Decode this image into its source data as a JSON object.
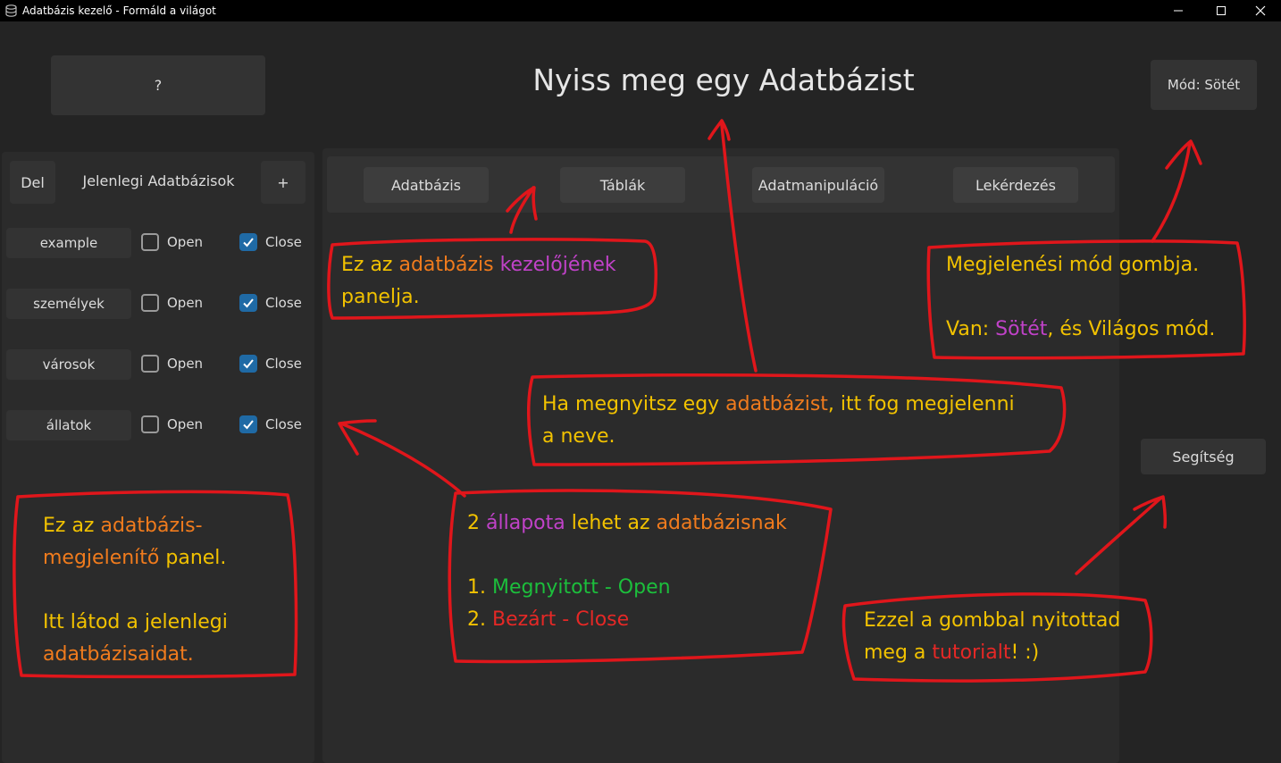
{
  "window": {
    "title": "Adatbázis kezelő - Formáld a világot",
    "minimize": "—",
    "maximize": "☐",
    "close": "✕"
  },
  "header": {
    "help_button": "?",
    "title": "Nyiss meg egy Adatbázist",
    "mode_button": "Mód: Sötét"
  },
  "sidebar": {
    "delete_button": "Del",
    "title": "Jelenlegi Adatbázisok",
    "add_button": "+",
    "databases": [
      {
        "name": "example",
        "open_label": "Open",
        "open_checked": false,
        "close_label": "Close",
        "close_checked": true
      },
      {
        "name": "személyek",
        "open_label": "Open",
        "open_checked": false,
        "close_label": "Close",
        "close_checked": true
      },
      {
        "name": "városok",
        "open_label": "Open",
        "open_checked": false,
        "close_label": "Close",
        "close_checked": true
      },
      {
        "name": "állatok",
        "open_label": "Open",
        "open_checked": false,
        "close_label": "Close",
        "close_checked": true
      }
    ]
  },
  "tabs": [
    {
      "label": "Adatbázis"
    },
    {
      "label": "Táblák"
    },
    {
      "label": "Adatmanipuláció"
    },
    {
      "label": "Lekérdezés"
    }
  ],
  "help_button": "Segítség",
  "annotations": {
    "manager_panel": {
      "t1": "Ez az ",
      "t2": "adatbázis",
      "t3": " ",
      "t4": "kezelőjének",
      "t5": "panelja."
    },
    "mode_note": {
      "t1": "Megjelenési mód gombja.",
      "t2": "Van: ",
      "t3": "Sötét",
      "t4": ", és Világos mód."
    },
    "db_name_note": {
      "t1": "Ha megnyitsz egy ",
      "t2": "adatbázist",
      "t3": ", itt fog megjelenni",
      "t4": "a neve."
    },
    "display_panel": {
      "t1": "Ez az ",
      "t2": "adatbázis-",
      "t3": "megjelenítő",
      "t4": " panel.",
      "t5": "Itt látod a jelenlegi",
      "t6": "adatbázisaidat."
    },
    "states_note": {
      "t1": "2 ",
      "t2": "állapota",
      "t3": " lehet az ",
      "t4": "adatbázisnak",
      "t5": "1. ",
      "t6": "Megnyitott - Open",
      "t7": "2. ",
      "t8": "Bezárt - Close"
    },
    "tutorial_note": {
      "t1": "Ezzel a gombbal nyitottad",
      "t2": "meg a ",
      "t3": "tutorialt",
      "t4": "! :)"
    }
  },
  "colors": {
    "background": "#242424",
    "panel": "#2b2b2b",
    "button": "#333333",
    "checkbox_checked": "#1f6aa5",
    "annotation_stroke": "#e0161b",
    "annotation_text": "#f2c200",
    "annotation_orange": "#f07b1d",
    "annotation_purple": "#c042c8",
    "annotation_green": "#1cbf3c",
    "annotation_red": "#e52826"
  }
}
